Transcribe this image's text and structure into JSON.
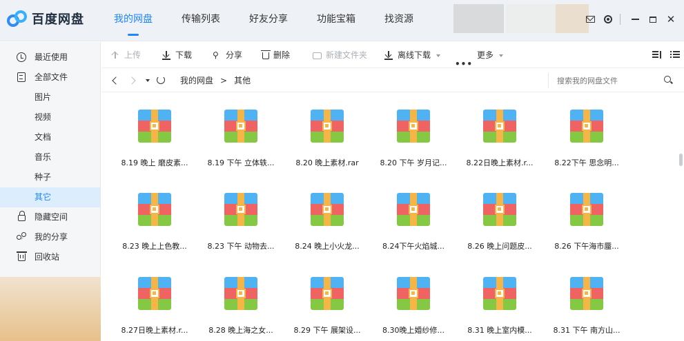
{
  "app": {
    "title": "百度网盘"
  },
  "topnav": [
    {
      "label": "我的网盘",
      "active": true
    },
    {
      "label": "传输列表",
      "active": false
    },
    {
      "label": "好友分享",
      "active": false
    },
    {
      "label": "功能宝箱",
      "active": false
    },
    {
      "label": "找资源",
      "active": false
    }
  ],
  "sidebar": {
    "items": [
      {
        "label": "最近使用",
        "icon": "clock-icon"
      },
      {
        "label": "全部文件",
        "icon": "document-icon"
      },
      {
        "label": "图片",
        "icon": ""
      },
      {
        "label": "视频",
        "icon": ""
      },
      {
        "label": "文档",
        "icon": ""
      },
      {
        "label": "音乐",
        "icon": ""
      },
      {
        "label": "种子",
        "icon": ""
      },
      {
        "label": "其它",
        "icon": "",
        "active": true
      },
      {
        "label": "隐藏空间",
        "icon": "lock-icon"
      },
      {
        "label": "我的分享",
        "icon": "share-icon"
      },
      {
        "label": "回收站",
        "icon": "trash-icon"
      }
    ]
  },
  "toolbar": {
    "upload": "上传",
    "download": "下载",
    "share": "分享",
    "delete": "删除",
    "new_folder": "新建文件夹",
    "offline_download": "离线下载",
    "more": "更多"
  },
  "pathbar": {
    "crumbs": [
      "我的网盘",
      "其他"
    ],
    "separator": ">",
    "search_placeholder": "搜索我的网盘文件"
  },
  "files": [
    "8.19 晚上 磨皮素...",
    "8.19 下午 立体轶...",
    "8.20 晚上素材.rar",
    "8.20 下午 岁月记...",
    "8.22日晚上素材.r...",
    "8.22下午 思念明...",
    "8.23 晚上上色教...",
    "8.23 下午 动物去...",
    "8.24 晚上小火龙...",
    "8.24下午火焰城...",
    "8.26 晚上问题皮...",
    "8.26 下午海市蜃...",
    "8.27日晚上素材.r...",
    "8.28 晚上海之女...",
    "8.29 下午 展架设...",
    "8.30晚上婚纱修...",
    "8.31 晚上室内模...",
    "8.31 下午 南方山..."
  ],
  "colors": {
    "accent": "#1f86ff",
    "zip_blue": "#4fb3f3",
    "zip_red": "#ef6363",
    "zip_green": "#85c844",
    "zip_belt": "#f6b547"
  }
}
